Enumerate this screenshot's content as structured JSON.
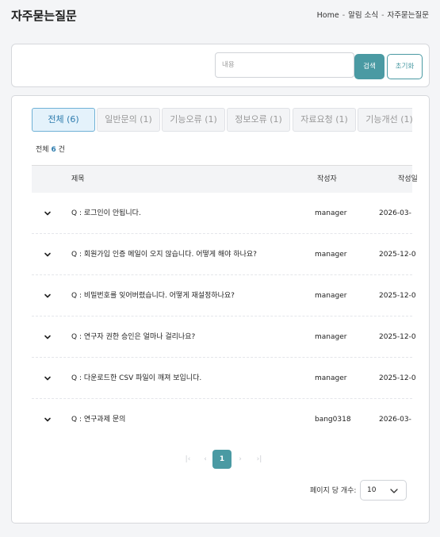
{
  "header": {
    "title": "자주묻는질문",
    "breadcrumb": [
      "Home",
      "알림 소식",
      "자주묻는질문"
    ],
    "breadcrumb_sep": "-"
  },
  "search": {
    "placeholder": "내용",
    "search_label": "검색",
    "reset_label": "초기화"
  },
  "tabs": [
    {
      "label": "전체 (6)",
      "active": true
    },
    {
      "label": "일반문의 (1)",
      "active": false
    },
    {
      "label": "기능오류 (1)",
      "active": false
    },
    {
      "label": "정보오류 (1)",
      "active": false
    },
    {
      "label": "자료요청 (1)",
      "active": false
    },
    {
      "label": "기능개선 (1)",
      "active": false
    }
  ],
  "total": {
    "prefix": "전체",
    "count": "6",
    "suffix": "건"
  },
  "table": {
    "columns": [
      "제목",
      "작성자",
      "작성일"
    ],
    "rows": [
      {
        "title": "Q : 로그인이 안됩니다.",
        "author": "manager",
        "date": "2026-03-"
      },
      {
        "title": "Q : 회원가입 인증 메일이 오지 않습니다. 어떻게 해야 하나요?",
        "author": "manager",
        "date": "2025-12-0"
      },
      {
        "title": "Q : 비밀번호를 잊어버렸습니다. 어떻게 재설정하나요?",
        "author": "manager",
        "date": "2025-12-0"
      },
      {
        "title": "Q : 연구자 권한 승인은 얼마나 걸리나요?",
        "author": "manager",
        "date": "2025-12-0"
      },
      {
        "title": "Q : 다운로드한 CSV 파일이 깨져 보입니다.",
        "author": "manager",
        "date": "2025-12-0"
      },
      {
        "title": "Q : 연구과제 문의",
        "author": "bang0318",
        "date": "2026-03-"
      }
    ]
  },
  "pagination": {
    "first": "|‹",
    "prev": "‹",
    "current": "1",
    "next": "›",
    "last": "›|"
  },
  "per_page": {
    "label": "페이지 당 개수:",
    "value": "10"
  },
  "colors": {
    "accent": "#4a9aa3",
    "tab_active": "#2e7cae"
  }
}
